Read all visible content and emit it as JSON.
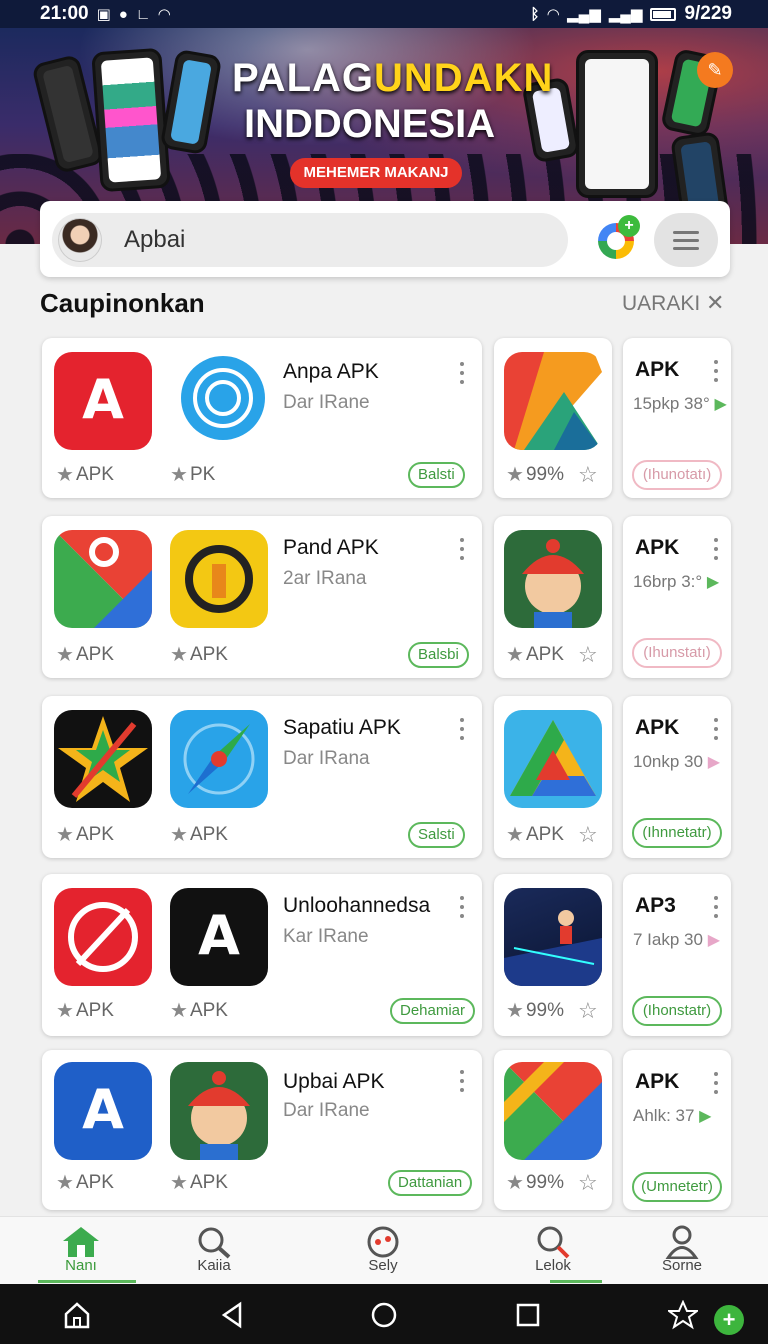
{
  "status_bar": {
    "time": "21:00",
    "date_right": "9/229"
  },
  "banner": {
    "title_line1_a": "PALAG",
    "title_line1_b": "UNDAKN",
    "title_line2": "INDDONESIA",
    "cta": "MEHEMER MAKANJ"
  },
  "search": {
    "value": "Apbai"
  },
  "section": {
    "title": "Caupinonkan",
    "more": "UARAKI",
    "close": "✕"
  },
  "rows": [
    {
      "icon1_rating": "APK",
      "icon2_rating": "PK",
      "name": "Anpa APK",
      "sub": "Dar IRane",
      "pill": "Balsti",
      "small_rating": "99%",
      "apk_title": "APK",
      "apk_sub": "15pkp 38°",
      "apk_pill": "(Ihunotatı)"
    },
    {
      "icon1_rating": "APK",
      "icon2_rating": "APK",
      "name": "Pand APK",
      "sub": "2ar IRana",
      "pill": "Balsbi",
      "small_rating": "APK",
      "apk_title": "APK",
      "apk_sub": "16brp 3:°",
      "apk_pill": "(Ihunstatı)"
    },
    {
      "icon1_rating": "APK",
      "icon2_rating": "APK",
      "name": "Sapatiu APK",
      "sub": "Dar IRana",
      "pill": "Salsti",
      "small_rating": "APK",
      "apk_title": "APK",
      "apk_sub": "10nkp 30",
      "apk_pill": "(Ihnnetatr)"
    },
    {
      "icon1_rating": "APK",
      "icon2_rating": "APK",
      "name": "Unloohannedsa",
      "sub": "Kar IRane",
      "pill": "Dehamiar",
      "small_rating": "99%",
      "apk_title": "AP3",
      "apk_sub": "7 Iakp 30",
      "apk_pill": "(Ihonstatr)"
    },
    {
      "icon1_rating": "APK",
      "icon2_rating": "APK",
      "name": "Upbai APK",
      "sub": "Dar IRane",
      "pill": "Dattanian",
      "small_rating": "99%",
      "apk_title": "APK",
      "apk_sub": "Ahlk: 37",
      "apk_pill": "(Umnetetr)"
    }
  ],
  "bottom_nav": [
    {
      "label": "Nanı",
      "icon": "home-icon"
    },
    {
      "label": "Kaiia",
      "icon": "search-icon"
    },
    {
      "label": "Sely",
      "icon": "game-icon"
    },
    {
      "label": "Lelok",
      "icon": "search-red-icon"
    },
    {
      "label": "Sorne",
      "icon": "person-icon"
    }
  ],
  "colors": {
    "accent": "#5cb85c",
    "status_bar": "#0f1a3a",
    "cta": "#e4322a"
  }
}
